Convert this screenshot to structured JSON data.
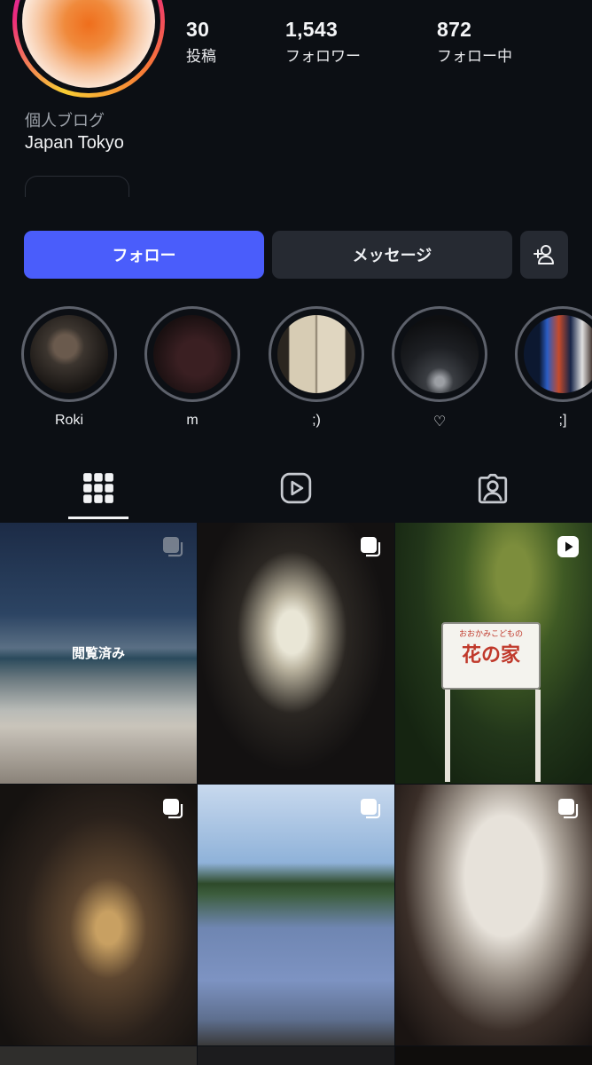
{
  "profile": {
    "stats": [
      {
        "value": "30",
        "label": "投稿"
      },
      {
        "value": "1,543",
        "label": "フォロワー"
      },
      {
        "value": "872",
        "label": "フォロー中"
      }
    ],
    "category": "個人ブログ",
    "location": "Japan Tokyo"
  },
  "actions": {
    "follow": "フォロー",
    "message": "メッセージ",
    "add_user_icon": "person-plus-icon"
  },
  "highlights": [
    {
      "name": "Roki"
    },
    {
      "name": "m"
    },
    {
      "name": ";)"
    },
    {
      "name": "♡"
    },
    {
      "name": ";]"
    }
  ],
  "tabs": [
    {
      "icon": "grid-icon",
      "active": true
    },
    {
      "icon": "reels-icon",
      "active": false
    },
    {
      "icon": "tagged-icon",
      "active": false
    }
  ],
  "grid": {
    "viewed_label": "閲覧済み",
    "sign_small": "おおかみこどもの",
    "sign_big": "花の家"
  },
  "colors": {
    "background": "#0c0f14",
    "follow_button": "#4a5dfb",
    "secondary_button": "#262a32"
  }
}
